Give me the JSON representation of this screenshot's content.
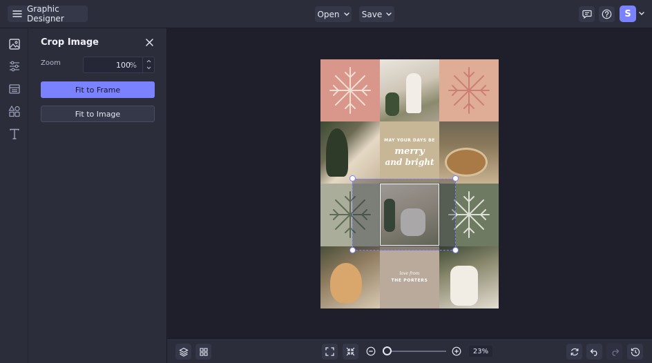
{
  "app": {
    "title": "Graphic Designer"
  },
  "toolbar": {
    "open_label": "Open",
    "save_label": "Save",
    "avatar_letter": "S"
  },
  "panel": {
    "title": "Crop Image",
    "zoom_label": "Zoom",
    "zoom_value": "100",
    "zoom_unit": "%",
    "fit_frame_label": "Fit to Frame",
    "fit_image_label": "Fit to Image"
  },
  "design": {
    "tile_text": {
      "arc": "MAY YOUR DAYS BE",
      "line1": "merry",
      "line2": "and bright",
      "love_from": "love from",
      "the_porters": "THE PORTERS"
    }
  },
  "bottom": {
    "zoom_percent": "23%",
    "zoom_slider_level": 0.0
  },
  "colors": {
    "accent": "#7b82ff",
    "pink": "#d8978a",
    "tan": "#c8b797",
    "sage": "#a9ad9a",
    "green": "#6f7a63",
    "taupe": "#b9aa9c"
  }
}
